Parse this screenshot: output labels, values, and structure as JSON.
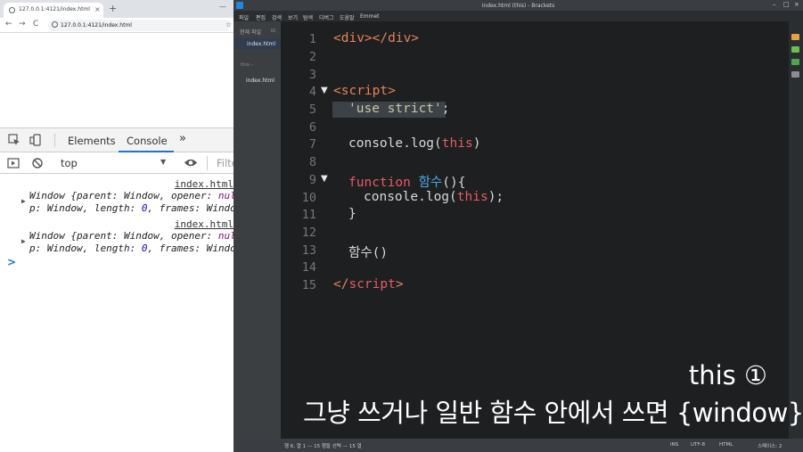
{
  "chrome": {
    "tab_title": "127.0.0.1:4121/index.html",
    "tab_close": "×",
    "new_tab": "+",
    "url": "127.0.0.1:4121/index.html",
    "nav_back": "←",
    "nav_forward": "→",
    "nav_reload": "C",
    "window_controls": "— ",
    "star": "☆"
  },
  "devtools": {
    "tabs": [
      "Elements",
      "Console"
    ],
    "active_tab": "Console",
    "more": "»",
    "context": "top",
    "filter_placeholder": "Filte",
    "messages": [
      {
        "source": "index.html",
        "line1_pre": "Window {parent: Window, opener: ",
        "line1_null": "null",
        "line1_post": ",",
        "line2_pre": "p: Window, length: ",
        "line2_num": "0",
        "line2_post": ", frames: Window,"
      },
      {
        "source": "index.html",
        "line1_pre": "Window {parent: Window, opener: ",
        "line1_null": "null",
        "line1_post": ",",
        "line2_pre": "p: Window, length: ",
        "line2_num": "0",
        "line2_post": ", frames: Window,"
      }
    ],
    "prompt": ">"
  },
  "brackets": {
    "title": "index.html (this) - Brackets",
    "menu": [
      "파일",
      "편집",
      "검색",
      "보기",
      "탐색",
      "디버그",
      "도움말",
      "Emmet"
    ],
    "sidebar": {
      "working_files_label": "현재 파일",
      "active_file": "index.html",
      "project": "this -",
      "project_file": "index.html"
    },
    "code": {
      "l1": {
        "a": "<div></div>"
      },
      "l4": {
        "a": "<script>"
      },
      "l5": {
        "a": "'use strict'",
        "b": ";"
      },
      "l7": {
        "a": "console.log(",
        "b": "this",
        "c": ")"
      },
      "l9": {
        "a": "function",
        "b": "함수",
        "c": "(){"
      },
      "l10": {
        "a": "console.log(",
        "b": "this",
        "c": ");"
      },
      "l11": {
        "a": "}"
      },
      "l13": {
        "a": "함수()"
      },
      "l15": {
        "a": "</",
        "b": "script",
        "c": ">"
      }
    },
    "status": {
      "position": "행 6, 열 1 — 15 행들 선택 — 15 열",
      "ins": "INS",
      "encoding": "UTF-8",
      "mode": "HTML",
      "spaces": "스페이스: 2"
    },
    "accent_colors": {
      "tag": "#e6825a",
      "keyword": "#e85a62",
      "function": "#4ea7e0",
      "string": "#c8c8a0"
    }
  },
  "subtitle": {
    "line1": "this ①",
    "line2": "그냥 쓰거나 일반 함수 안에서 쓰면 {window}"
  }
}
